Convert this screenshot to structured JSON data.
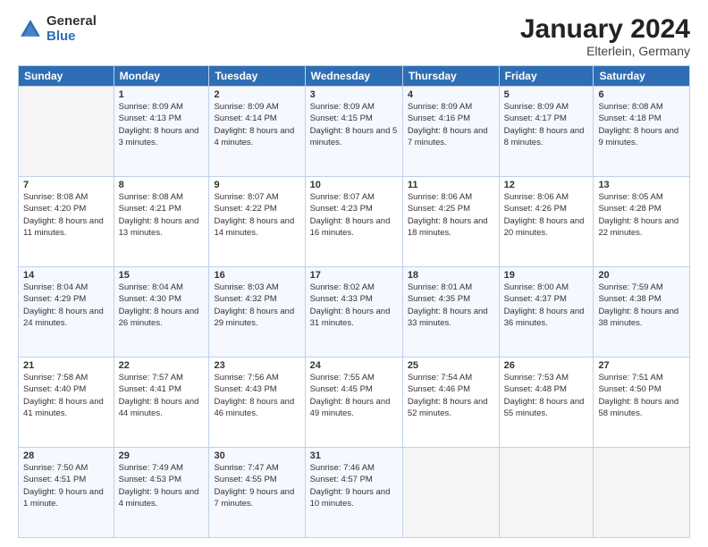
{
  "logo": {
    "general": "General",
    "blue": "Blue"
  },
  "title": "January 2024",
  "subtitle": "Elterlein, Germany",
  "days": [
    "Sunday",
    "Monday",
    "Tuesday",
    "Wednesday",
    "Thursday",
    "Friday",
    "Saturday"
  ],
  "weeks": [
    [
      {
        "num": "",
        "sunrise": "",
        "sunset": "",
        "daylight": ""
      },
      {
        "num": "1",
        "sunrise": "Sunrise: 8:09 AM",
        "sunset": "Sunset: 4:13 PM",
        "daylight": "Daylight: 8 hours and 3 minutes."
      },
      {
        "num": "2",
        "sunrise": "Sunrise: 8:09 AM",
        "sunset": "Sunset: 4:14 PM",
        "daylight": "Daylight: 8 hours and 4 minutes."
      },
      {
        "num": "3",
        "sunrise": "Sunrise: 8:09 AM",
        "sunset": "Sunset: 4:15 PM",
        "daylight": "Daylight: 8 hours and 5 minutes."
      },
      {
        "num": "4",
        "sunrise": "Sunrise: 8:09 AM",
        "sunset": "Sunset: 4:16 PM",
        "daylight": "Daylight: 8 hours and 7 minutes."
      },
      {
        "num": "5",
        "sunrise": "Sunrise: 8:09 AM",
        "sunset": "Sunset: 4:17 PM",
        "daylight": "Daylight: 8 hours and 8 minutes."
      },
      {
        "num": "6",
        "sunrise": "Sunrise: 8:08 AM",
        "sunset": "Sunset: 4:18 PM",
        "daylight": "Daylight: 8 hours and 9 minutes."
      }
    ],
    [
      {
        "num": "7",
        "sunrise": "Sunrise: 8:08 AM",
        "sunset": "Sunset: 4:20 PM",
        "daylight": "Daylight: 8 hours and 11 minutes."
      },
      {
        "num": "8",
        "sunrise": "Sunrise: 8:08 AM",
        "sunset": "Sunset: 4:21 PM",
        "daylight": "Daylight: 8 hours and 13 minutes."
      },
      {
        "num": "9",
        "sunrise": "Sunrise: 8:07 AM",
        "sunset": "Sunset: 4:22 PM",
        "daylight": "Daylight: 8 hours and 14 minutes."
      },
      {
        "num": "10",
        "sunrise": "Sunrise: 8:07 AM",
        "sunset": "Sunset: 4:23 PM",
        "daylight": "Daylight: 8 hours and 16 minutes."
      },
      {
        "num": "11",
        "sunrise": "Sunrise: 8:06 AM",
        "sunset": "Sunset: 4:25 PM",
        "daylight": "Daylight: 8 hours and 18 minutes."
      },
      {
        "num": "12",
        "sunrise": "Sunrise: 8:06 AM",
        "sunset": "Sunset: 4:26 PM",
        "daylight": "Daylight: 8 hours and 20 minutes."
      },
      {
        "num": "13",
        "sunrise": "Sunrise: 8:05 AM",
        "sunset": "Sunset: 4:28 PM",
        "daylight": "Daylight: 8 hours and 22 minutes."
      }
    ],
    [
      {
        "num": "14",
        "sunrise": "Sunrise: 8:04 AM",
        "sunset": "Sunset: 4:29 PM",
        "daylight": "Daylight: 8 hours and 24 minutes."
      },
      {
        "num": "15",
        "sunrise": "Sunrise: 8:04 AM",
        "sunset": "Sunset: 4:30 PM",
        "daylight": "Daylight: 8 hours and 26 minutes."
      },
      {
        "num": "16",
        "sunrise": "Sunrise: 8:03 AM",
        "sunset": "Sunset: 4:32 PM",
        "daylight": "Daylight: 8 hours and 29 minutes."
      },
      {
        "num": "17",
        "sunrise": "Sunrise: 8:02 AM",
        "sunset": "Sunset: 4:33 PM",
        "daylight": "Daylight: 8 hours and 31 minutes."
      },
      {
        "num": "18",
        "sunrise": "Sunrise: 8:01 AM",
        "sunset": "Sunset: 4:35 PM",
        "daylight": "Daylight: 8 hours and 33 minutes."
      },
      {
        "num": "19",
        "sunrise": "Sunrise: 8:00 AM",
        "sunset": "Sunset: 4:37 PM",
        "daylight": "Daylight: 8 hours and 36 minutes."
      },
      {
        "num": "20",
        "sunrise": "Sunrise: 7:59 AM",
        "sunset": "Sunset: 4:38 PM",
        "daylight": "Daylight: 8 hours and 38 minutes."
      }
    ],
    [
      {
        "num": "21",
        "sunrise": "Sunrise: 7:58 AM",
        "sunset": "Sunset: 4:40 PM",
        "daylight": "Daylight: 8 hours and 41 minutes."
      },
      {
        "num": "22",
        "sunrise": "Sunrise: 7:57 AM",
        "sunset": "Sunset: 4:41 PM",
        "daylight": "Daylight: 8 hours and 44 minutes."
      },
      {
        "num": "23",
        "sunrise": "Sunrise: 7:56 AM",
        "sunset": "Sunset: 4:43 PM",
        "daylight": "Daylight: 8 hours and 46 minutes."
      },
      {
        "num": "24",
        "sunrise": "Sunrise: 7:55 AM",
        "sunset": "Sunset: 4:45 PM",
        "daylight": "Daylight: 8 hours and 49 minutes."
      },
      {
        "num": "25",
        "sunrise": "Sunrise: 7:54 AM",
        "sunset": "Sunset: 4:46 PM",
        "daylight": "Daylight: 8 hours and 52 minutes."
      },
      {
        "num": "26",
        "sunrise": "Sunrise: 7:53 AM",
        "sunset": "Sunset: 4:48 PM",
        "daylight": "Daylight: 8 hours and 55 minutes."
      },
      {
        "num": "27",
        "sunrise": "Sunrise: 7:51 AM",
        "sunset": "Sunset: 4:50 PM",
        "daylight": "Daylight: 8 hours and 58 minutes."
      }
    ],
    [
      {
        "num": "28",
        "sunrise": "Sunrise: 7:50 AM",
        "sunset": "Sunset: 4:51 PM",
        "daylight": "Daylight: 9 hours and 1 minute."
      },
      {
        "num": "29",
        "sunrise": "Sunrise: 7:49 AM",
        "sunset": "Sunset: 4:53 PM",
        "daylight": "Daylight: 9 hours and 4 minutes."
      },
      {
        "num": "30",
        "sunrise": "Sunrise: 7:47 AM",
        "sunset": "Sunset: 4:55 PM",
        "daylight": "Daylight: 9 hours and 7 minutes."
      },
      {
        "num": "31",
        "sunrise": "Sunrise: 7:46 AM",
        "sunset": "Sunset: 4:57 PM",
        "daylight": "Daylight: 9 hours and 10 minutes."
      },
      {
        "num": "",
        "sunrise": "",
        "sunset": "",
        "daylight": ""
      },
      {
        "num": "",
        "sunrise": "",
        "sunset": "",
        "daylight": ""
      },
      {
        "num": "",
        "sunrise": "",
        "sunset": "",
        "daylight": ""
      }
    ]
  ]
}
